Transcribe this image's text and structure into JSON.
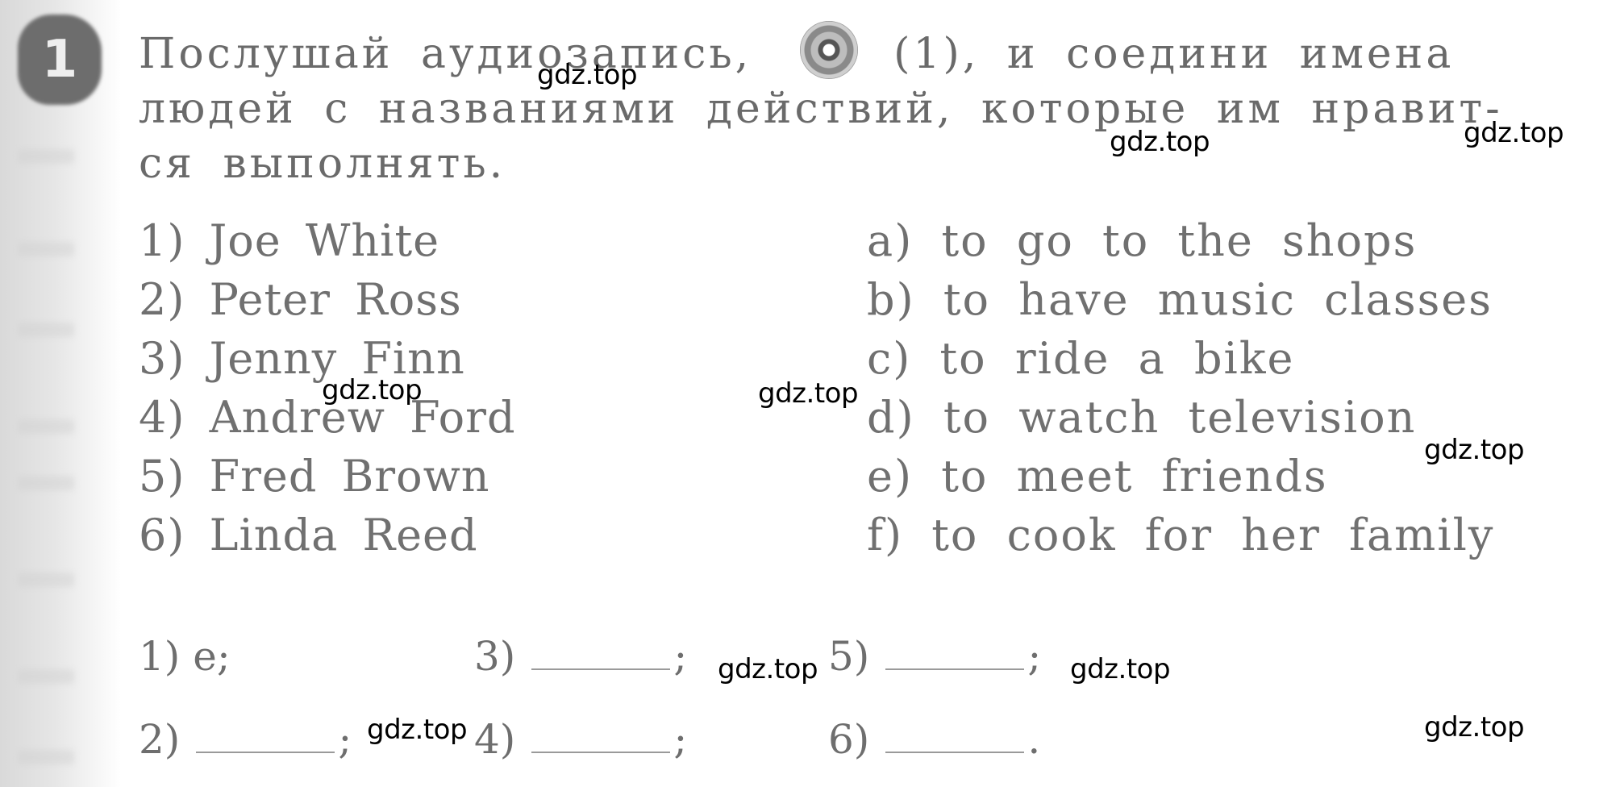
{
  "exercise": {
    "number": "1",
    "instruction_lines": [
      {
        "before_icon": "Послушай аудиозапись,",
        "icon": "audio-cd-icon",
        "after_icon": "(1), и соедини имена"
      },
      {
        "text": "людей с названиями действий, которые им нравит-"
      },
      {
        "text": "ся выполнять."
      }
    ]
  },
  "names": [
    {
      "num": "1)",
      "name": "Joe White"
    },
    {
      "num": "2)",
      "name": "Peter Ross"
    },
    {
      "num": "3)",
      "name": "Jenny Finn"
    },
    {
      "num": "4)",
      "name": "Andrew Ford"
    },
    {
      "num": "5)",
      "name": "Fred Brown"
    },
    {
      "num": "6)",
      "name": "Linda Reed"
    }
  ],
  "actions": [
    {
      "letter": "a)",
      "text": "to go to the shops"
    },
    {
      "letter": "b)",
      "text": "to have music classes"
    },
    {
      "letter": "c)",
      "text": "to ride a bike"
    },
    {
      "letter": "d)",
      "text": "to watch television"
    },
    {
      "letter": "e)",
      "text": "to meet friends"
    },
    {
      "letter": "f)",
      "text": "to cook for her family"
    }
  ],
  "answers": [
    {
      "num": "1)",
      "value": "e",
      "sep": ";"
    },
    {
      "num": "2)",
      "value": "",
      "sep": ";"
    },
    {
      "num": "3)",
      "value": "",
      "sep": ";"
    },
    {
      "num": "4)",
      "value": "",
      "sep": ";"
    },
    {
      "num": "5)",
      "value": "",
      "sep": ";"
    },
    {
      "num": "6)",
      "value": "",
      "sep": "."
    }
  ],
  "watermark": {
    "text": "gdz.top"
  }
}
